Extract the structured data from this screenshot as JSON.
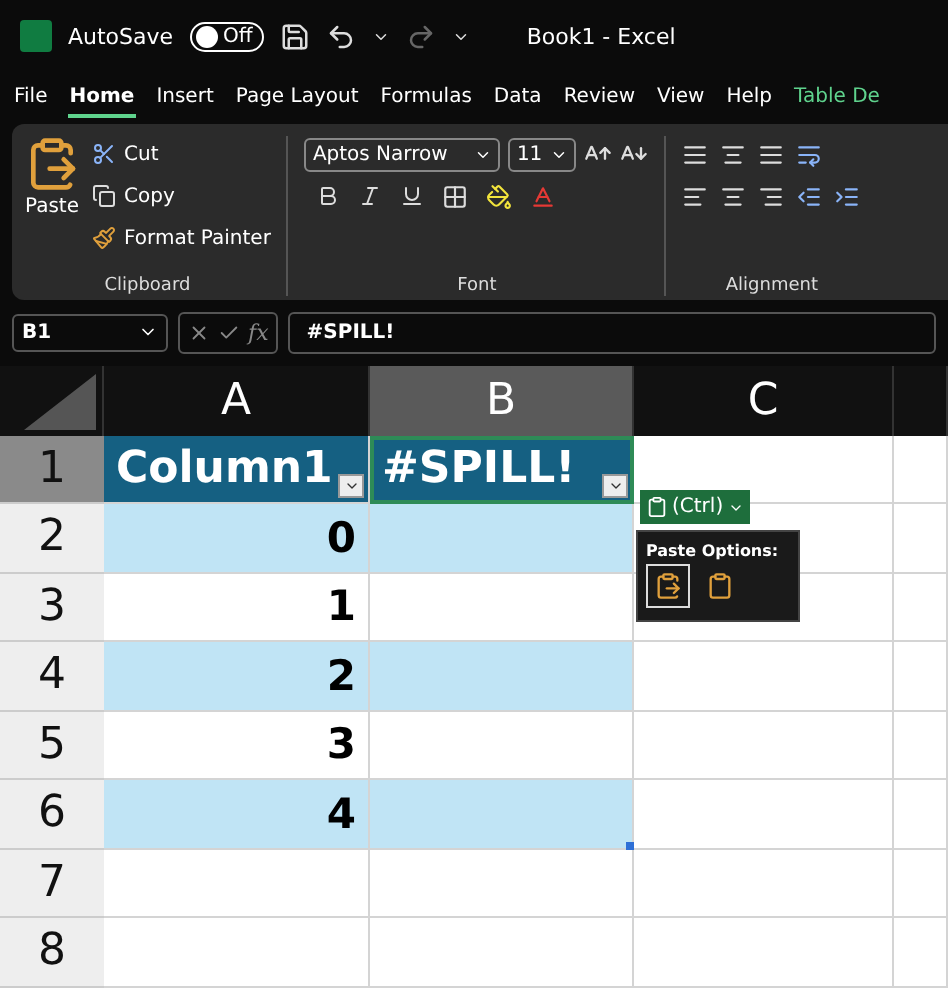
{
  "title_bar": {
    "autosave_label": "AutoSave",
    "autosave": {
      "on": false,
      "label": "Off"
    },
    "title": "Book1  -  Excel"
  },
  "tabs": [
    {
      "label": "File",
      "selected": false,
      "contextual": false
    },
    {
      "label": "Home",
      "selected": true,
      "contextual": false
    },
    {
      "label": "Insert",
      "selected": false,
      "contextual": false
    },
    {
      "label": "Page Layout",
      "selected": false,
      "contextual": false
    },
    {
      "label": "Formulas",
      "selected": false,
      "contextual": false
    },
    {
      "label": "Data",
      "selected": false,
      "contextual": false
    },
    {
      "label": "Review",
      "selected": false,
      "contextual": false
    },
    {
      "label": "View",
      "selected": false,
      "contextual": false
    },
    {
      "label": "Help",
      "selected": false,
      "contextual": false
    },
    {
      "label": "Table De",
      "selected": false,
      "contextual": true
    }
  ],
  "ribbon": {
    "clipboard": {
      "paste": "Paste",
      "cut": "Cut",
      "copy": "Copy",
      "format_painter": "Format Painter",
      "group": "Clipboard"
    },
    "font": {
      "font_name": "Aptos Narrow",
      "font_size": "11",
      "group": "Font"
    },
    "alignment": {
      "group": "Alignment"
    }
  },
  "formula_bar": {
    "name_box": "B1",
    "fx": "fx",
    "formula": "#SPILL!"
  },
  "sheet": {
    "columns": [
      {
        "label": "A",
        "selected": false
      },
      {
        "label": "B",
        "selected": true
      },
      {
        "label": "C",
        "selected": false
      }
    ],
    "rows": [
      {
        "header": "1",
        "selected": true,
        "banded": false,
        "cells": [
          {
            "text": "Column1",
            "kind": "header"
          },
          {
            "text": "#SPILL!",
            "kind": "header"
          }
        ]
      },
      {
        "header": "2",
        "selected": false,
        "banded": true,
        "cells": [
          {
            "text": "0",
            "kind": "number"
          }
        ]
      },
      {
        "header": "3",
        "selected": false,
        "banded": false,
        "cells": [
          {
            "text": "1",
            "kind": "number"
          }
        ]
      },
      {
        "header": "4",
        "selected": false,
        "banded": true,
        "cells": [
          {
            "text": "2",
            "kind": "number"
          }
        ]
      },
      {
        "header": "5",
        "selected": false,
        "banded": false,
        "cells": [
          {
            "text": "3",
            "kind": "number"
          }
        ]
      },
      {
        "header": "6",
        "selected": false,
        "banded": true,
        "cells": [
          {
            "text": "4",
            "kind": "number"
          }
        ]
      },
      {
        "header": "7",
        "selected": false,
        "banded": false,
        "cells": []
      },
      {
        "header": "8",
        "selected": false,
        "banded": false,
        "cells": []
      }
    ]
  },
  "paste_popup": {
    "button": "(Ctrl)",
    "title": "Paste Options:"
  }
}
